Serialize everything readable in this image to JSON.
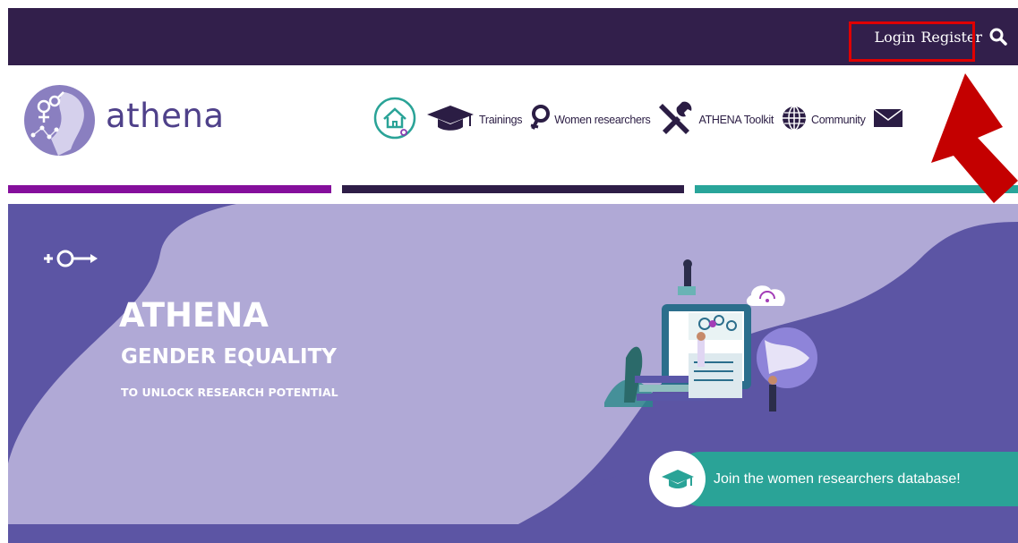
{
  "header": {
    "login_label": "Login",
    "register_label": "Register",
    "search_icon": "search-icon"
  },
  "brand": {
    "name": "athena",
    "logo_icon": "athena-logo-icon"
  },
  "nav": {
    "items": [
      {
        "label": "",
        "icon": "home-icon"
      },
      {
        "label": "Trainings",
        "icon": "graduation-cap-icon"
      },
      {
        "label": "Women researchers",
        "icon": "female-symbol-icon"
      },
      {
        "label": "ATHENA Toolkit",
        "icon": "tools-icon"
      },
      {
        "label": "Community",
        "icon": "globe-icon"
      },
      {
        "label": "",
        "icon": "envelope-icon"
      }
    ]
  },
  "hero": {
    "title": "ATHENA",
    "subtitle": "GENDER EQUALITY",
    "tagline": "TO UNLOCK RESEARCH POTENTIAL",
    "symbol_icon": "gender-symbol-icon",
    "cta_label": "Join the women researchers database!",
    "cta_icon": "graduation-cap-icon"
  },
  "colors": {
    "topbar": "#321f4b",
    "stripe_purple": "#850f9c",
    "stripe_dark": "#2e1d47",
    "stripe_teal": "#29a59a",
    "hero_dark": "#5c55a4",
    "hero_light": "#b0a9d6",
    "cta_teal": "#2aa397",
    "annotation_red": "#e00000"
  }
}
